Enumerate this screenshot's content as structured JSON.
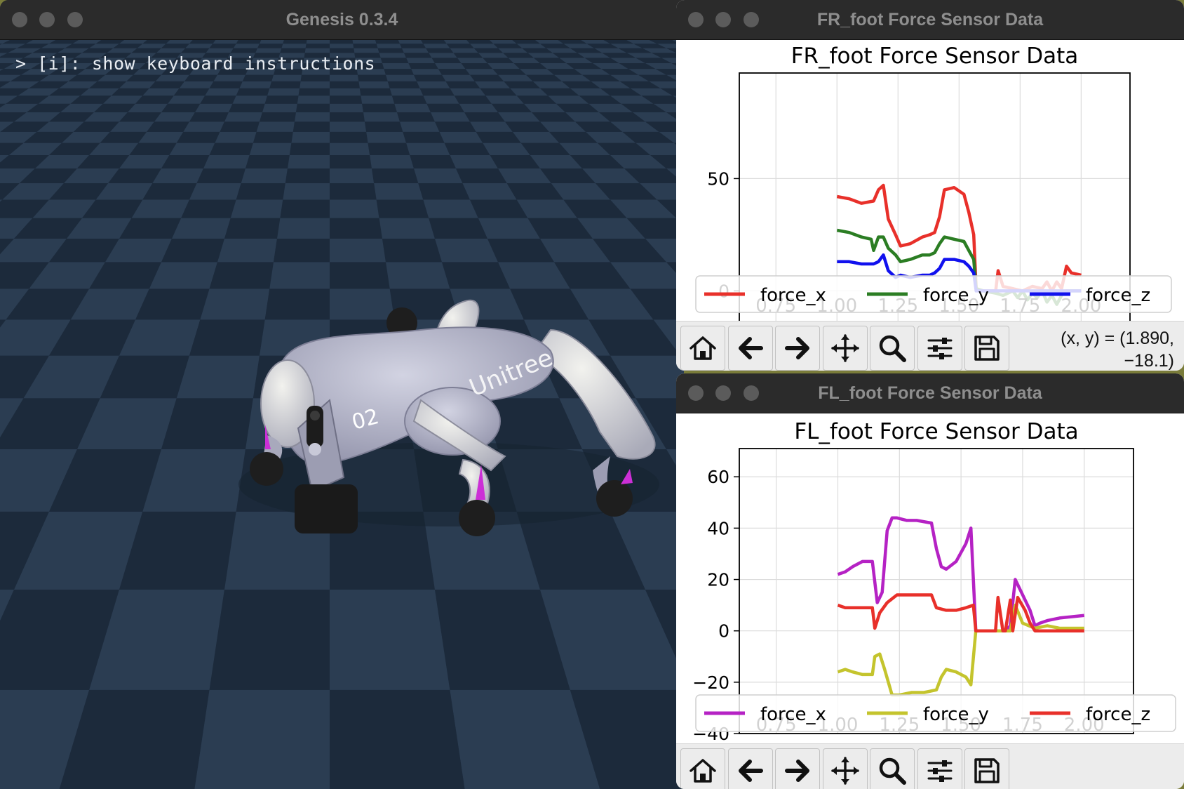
{
  "main_window": {
    "title": "Genesis 0.3.4",
    "hint": "> [i]: show keyboard instructions",
    "robot": {
      "brand_text": "Unitree",
      "number_text": "02"
    }
  },
  "fr_window": {
    "title": "FR_foot Force Sensor Data",
    "coords": [
      "(x, y) = (1.890,",
      "−18.1)"
    ],
    "toolbar": [
      "home-icon",
      "back-arrow-icon",
      "forward-arrow-icon",
      "pan-icon",
      "zoom-icon",
      "configure-subplots-icon",
      "save-icon"
    ]
  },
  "fl_window": {
    "title": "FL_foot Force Sensor Data",
    "toolbar": [
      "home-icon",
      "back-arrow-icon",
      "forward-arrow-icon",
      "pan-icon",
      "zoom-icon",
      "configure-subplots-icon",
      "save-icon"
    ]
  },
  "chart_data": [
    {
      "type": "line",
      "title": "FR_foot Force Sensor Data",
      "xlim": [
        0.6,
        2.2
      ],
      "ylim": [
        -18,
        97
      ],
      "xticks": [
        0.75,
        1.0,
        1.25,
        1.5,
        1.75,
        2.0
      ],
      "xtick_labels": [
        "0.75",
        "1.00",
        "1.25",
        "1.50",
        "1.75",
        "2.00"
      ],
      "yticks": [
        0,
        50
      ],
      "ytick_labels": [
        "0",
        "50"
      ],
      "grid": true,
      "legend_position": "bottom",
      "series": [
        {
          "name": "force_x",
          "color": "#e8302a",
          "x": [
            1.0,
            1.05,
            1.1,
            1.15,
            1.17,
            1.19,
            1.21,
            1.24,
            1.26,
            1.3,
            1.35,
            1.38,
            1.4,
            1.42,
            1.44,
            1.48,
            1.52,
            1.54,
            1.56,
            1.57,
            1.6,
            1.65,
            1.66,
            1.68,
            1.72,
            1.76,
            1.8,
            1.84,
            1.86,
            1.88,
            1.9,
            1.92,
            1.94,
            1.96,
            2.0
          ],
          "y": [
            42,
            41,
            39,
            40,
            45,
            47,
            32,
            25,
            20,
            21,
            24,
            25,
            26,
            33,
            45,
            46,
            43,
            35,
            25,
            1,
            0,
            0,
            9,
            2,
            1,
            0,
            2,
            1,
            4,
            0,
            4,
            1,
            11,
            8,
            7
          ]
        },
        {
          "name": "force_y",
          "color": "#2b7d23",
          "x": [
            1.0,
            1.05,
            1.1,
            1.14,
            1.15,
            1.17,
            1.19,
            1.21,
            1.24,
            1.26,
            1.3,
            1.35,
            1.38,
            1.4,
            1.42,
            1.44,
            1.48,
            1.52,
            1.54,
            1.56,
            1.57,
            1.6,
            1.65,
            1.68,
            1.72,
            1.74,
            1.76,
            1.78,
            1.8,
            1.82,
            1.84,
            1.86,
            1.88,
            1.9,
            1.92,
            1.94,
            2.0
          ],
          "y": [
            27,
            26,
            24,
            23,
            18,
            24,
            24,
            19,
            16,
            13,
            14,
            16,
            16,
            17,
            21,
            24,
            23,
            22,
            18,
            14,
            1,
            0,
            -1,
            -2,
            0,
            -3,
            0,
            -4,
            -1,
            -3,
            0,
            -5,
            -2,
            -6,
            -2,
            0,
            0
          ]
        },
        {
          "name": "force_z",
          "color": "#1111ee",
          "x": [
            1.0,
            1.05,
            1.1,
            1.15,
            1.17,
            1.19,
            1.21,
            1.24,
            1.26,
            1.3,
            1.35,
            1.38,
            1.4,
            1.42,
            1.44,
            1.48,
            1.52,
            1.54,
            1.56,
            1.57,
            1.6,
            1.65,
            1.7,
            1.8,
            1.9,
            2.0
          ],
          "y": [
            13,
            13,
            12,
            12,
            13,
            16,
            9,
            6,
            7,
            6,
            7,
            7,
            8,
            10,
            14,
            14,
            13,
            11,
            8,
            0,
            0,
            0,
            0,
            0,
            0,
            0
          ]
        }
      ]
    },
    {
      "type": "line",
      "title": "FL_foot Force Sensor Data",
      "xlim": [
        0.6,
        2.2
      ],
      "ylim": [
        -40,
        71
      ],
      "xticks": [
        0.75,
        1.0,
        1.25,
        1.5,
        1.75,
        2.0
      ],
      "xtick_labels": [
        "0.75",
        "1.00",
        "1.25",
        "1.50",
        "1.75",
        "2.00"
      ],
      "yticks": [
        -40,
        -20,
        0,
        20,
        40,
        60
      ],
      "ytick_labels": [
        "−40",
        "−20",
        "0",
        "20",
        "40",
        "60"
      ],
      "grid": true,
      "legend_position": "bottom",
      "series": [
        {
          "name": "force_x",
          "color": "#b522c4",
          "x": [
            1.0,
            1.03,
            1.06,
            1.1,
            1.14,
            1.16,
            1.18,
            1.2,
            1.22,
            1.24,
            1.28,
            1.32,
            1.38,
            1.4,
            1.42,
            1.44,
            1.48,
            1.52,
            1.54,
            1.56,
            1.6,
            1.64,
            1.66,
            1.68,
            1.7,
            1.72,
            1.76,
            1.78,
            1.8,
            1.82,
            1.85,
            1.9,
            2.0
          ],
          "y": [
            22,
            23,
            25,
            27,
            27,
            11,
            15,
            39,
            44,
            44,
            43,
            43,
            42,
            32,
            25,
            24,
            27,
            34,
            40,
            0,
            0,
            0,
            0,
            0,
            2,
            20,
            12,
            8,
            2,
            3,
            4,
            5,
            6
          ]
        },
        {
          "name": "force_y",
          "color": "#c4c42d",
          "x": [
            1.0,
            1.03,
            1.06,
            1.1,
            1.14,
            1.15,
            1.17,
            1.19,
            1.22,
            1.25,
            1.3,
            1.35,
            1.4,
            1.42,
            1.44,
            1.48,
            1.52,
            1.54,
            1.56,
            1.6,
            1.65,
            1.7,
            1.72,
            1.75,
            1.8,
            1.85,
            1.9,
            2.0
          ],
          "y": [
            -16,
            -15,
            -16,
            -17,
            -17,
            -10,
            -9,
            -15,
            -25,
            -25,
            -24,
            -24,
            -23,
            -18,
            -15,
            -16,
            -18,
            -21,
            0,
            0,
            0,
            0,
            10,
            3,
            1,
            2,
            1,
            1
          ]
        },
        {
          "name": "force_z",
          "color": "#e8302a",
          "x": [
            1.0,
            1.03,
            1.06,
            1.1,
            1.14,
            1.15,
            1.17,
            1.2,
            1.24,
            1.3,
            1.38,
            1.4,
            1.44,
            1.48,
            1.52,
            1.55,
            1.56,
            1.6,
            1.64,
            1.65,
            1.67,
            1.68,
            1.7,
            1.71,
            1.73,
            1.76,
            1.78,
            1.8,
            1.85,
            1.9,
            2.0
          ],
          "y": [
            10,
            9,
            9,
            9,
            9,
            1,
            7,
            11,
            14,
            14,
            14,
            9,
            8,
            8,
            9,
            10,
            0,
            0,
            0,
            13,
            0,
            0,
            12,
            0,
            13,
            8,
            3,
            0,
            0,
            0,
            0
          ]
        }
      ]
    }
  ]
}
